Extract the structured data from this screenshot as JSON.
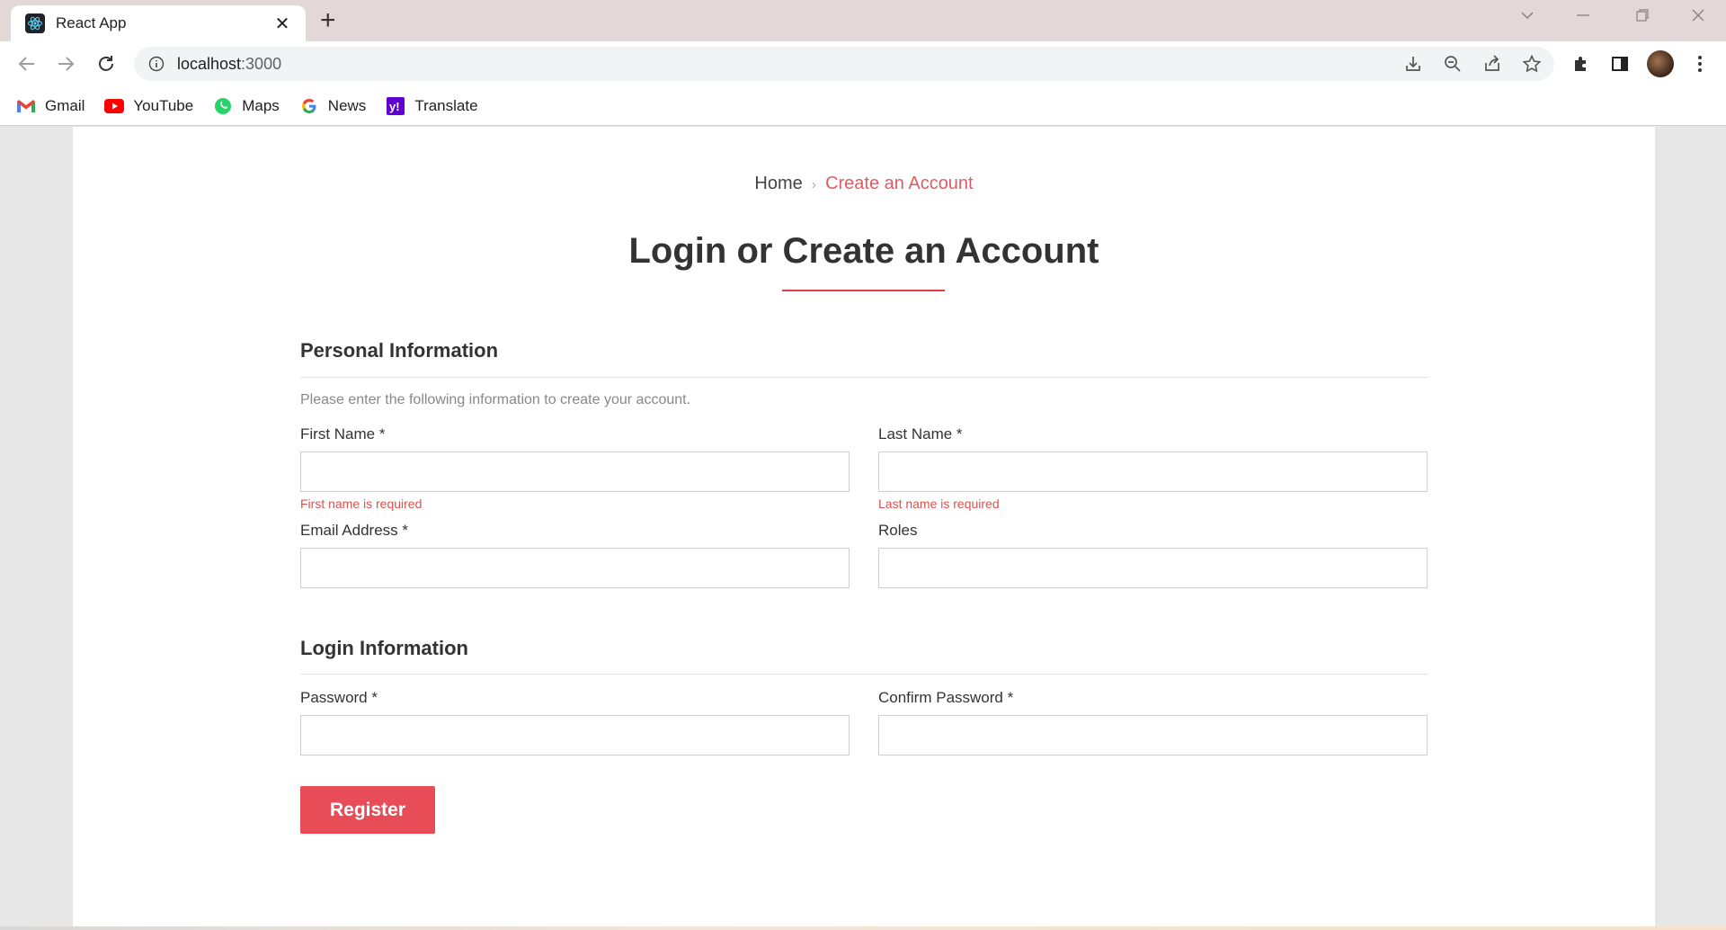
{
  "browser": {
    "tab_title": "React App",
    "tab_close": "✕",
    "new_tab": "+",
    "url_host": "localhost",
    "url_port": ":3000",
    "bookmarks": [
      {
        "label": "Gmail",
        "icon": "gmail-icon"
      },
      {
        "label": "YouTube",
        "icon": "youtube-icon"
      },
      {
        "label": "Maps",
        "icon": "maps-icon"
      },
      {
        "label": "News",
        "icon": "google-news-icon"
      },
      {
        "label": "Translate",
        "icon": "yahoo-icon"
      }
    ]
  },
  "page": {
    "breadcrumb": {
      "home": "Home",
      "separator": "›",
      "current": "Create an Account"
    },
    "title": "Login or Create an Account",
    "personal": {
      "heading": "Personal Information",
      "intro": "Please enter the following information to create your account.",
      "first_name_label": "First Name *",
      "first_name_error": "First name is required",
      "last_name_label": "Last Name *",
      "last_name_error": "Last name is required",
      "email_label": "Email Address *",
      "roles_label": "Roles"
    },
    "login": {
      "heading": "Login Information",
      "password_label": "Password *",
      "confirm_label": "Confirm Password *"
    },
    "register_label": "Register"
  },
  "colors": {
    "accent": "#e84c57",
    "error": "#d9534f",
    "breadcrumb_current": "#e05c63"
  }
}
